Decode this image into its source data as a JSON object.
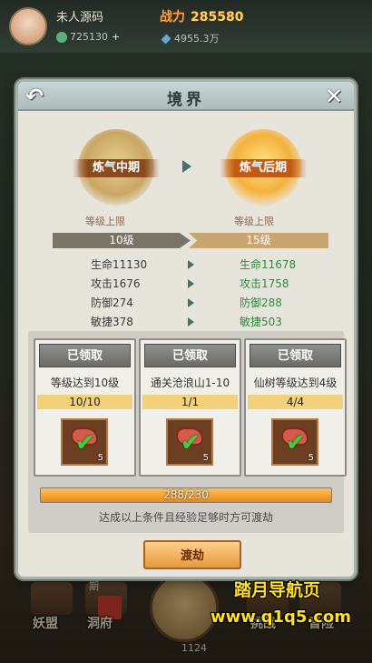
{
  "top_bar": {
    "player_name": "未人源码",
    "power_label": "战力",
    "power_value": "285580",
    "res1_value": "725130",
    "res1_plus": "+",
    "res2_value": "4955.3万"
  },
  "modal": {
    "title": "境界",
    "back_icon": "back-arrow-icon",
    "close_icon": "close-x-icon",
    "current_realm": "炼气中期",
    "next_realm": "炼气后期",
    "level_caption_left": "等级上限",
    "level_caption_right": "等级上限",
    "level_left": "10级",
    "level_right": "15级",
    "stats_old": [
      "生命11130",
      "攻击1676",
      "防御274",
      "敏捷378"
    ],
    "stats_new": [
      "生命11678",
      "攻击1758",
      "防御288",
      "敏捷503"
    ],
    "tasks": [
      {
        "status": "已领取",
        "name": "等级达到10级",
        "progress": "10/10",
        "reward_count": "5"
      },
      {
        "status": "已领取",
        "name": "通关沧浪山1-10",
        "progress": "1/1",
        "reward_count": "5"
      },
      {
        "status": "已领取",
        "name": "仙树等级达到4级",
        "progress": "4/4",
        "reward_count": "5"
      }
    ],
    "exp_text": "288/230",
    "exp_fraction": 1.0,
    "hint": "达成以上条件且经验足够时方可渡劫",
    "break_button": "渡劫"
  },
  "bottom_nav": {
    "item1": "妖盟",
    "item2": "洞府",
    "item3": "挑战",
    "item4": "冒险",
    "small_text": "期",
    "center_value": "1124"
  },
  "watermark": {
    "line1": "踏月导航页",
    "line2": "www.q1q5.com"
  },
  "colors": {
    "accent_orange": "#e59a3c",
    "stat_up_green": "#2d8a3a",
    "watermark_yellow": "#ffe02a"
  }
}
